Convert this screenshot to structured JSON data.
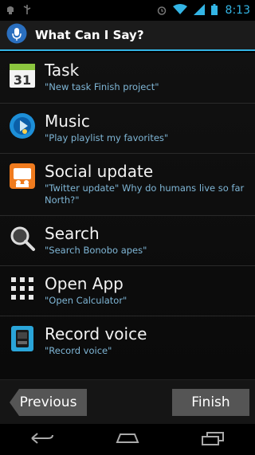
{
  "status_bar": {
    "time": "8:13",
    "icons": [
      "usb-debug-icon",
      "usb-icon",
      "alarm-icon",
      "wifi-icon",
      "signal-icon",
      "battery-icon"
    ]
  },
  "action_bar": {
    "title": "What Can I Say?",
    "icon": "microphone-icon"
  },
  "items": [
    {
      "title": "Task",
      "subtitle": "\"New task Finish project\"",
      "icon": "calendar-icon"
    },
    {
      "title": "Music",
      "subtitle": "\"Play playlist my favorites\"",
      "icon": "music-icon"
    },
    {
      "title": "Social update",
      "subtitle": "\"Twitter update\" Why do humans live so far North?\"",
      "icon": "social-icon"
    },
    {
      "title": "Search",
      "subtitle": "\"Search Bonobo apes\"",
      "icon": "search-icon"
    },
    {
      "title": "Open App",
      "subtitle": "\"Open Calculator\"",
      "icon": "apps-grid-icon"
    },
    {
      "title": "Record voice",
      "subtitle": "\"Record voice\"",
      "icon": "voice-recorder-icon"
    }
  ],
  "buttons": {
    "previous": "Previous",
    "finish": "Finish"
  },
  "nav_bar": {
    "icons": [
      "back-icon",
      "home-icon",
      "recent-apps-icon"
    ]
  },
  "colors": {
    "accent": "#33b5e5",
    "subtitle": "#7fb6d6"
  }
}
